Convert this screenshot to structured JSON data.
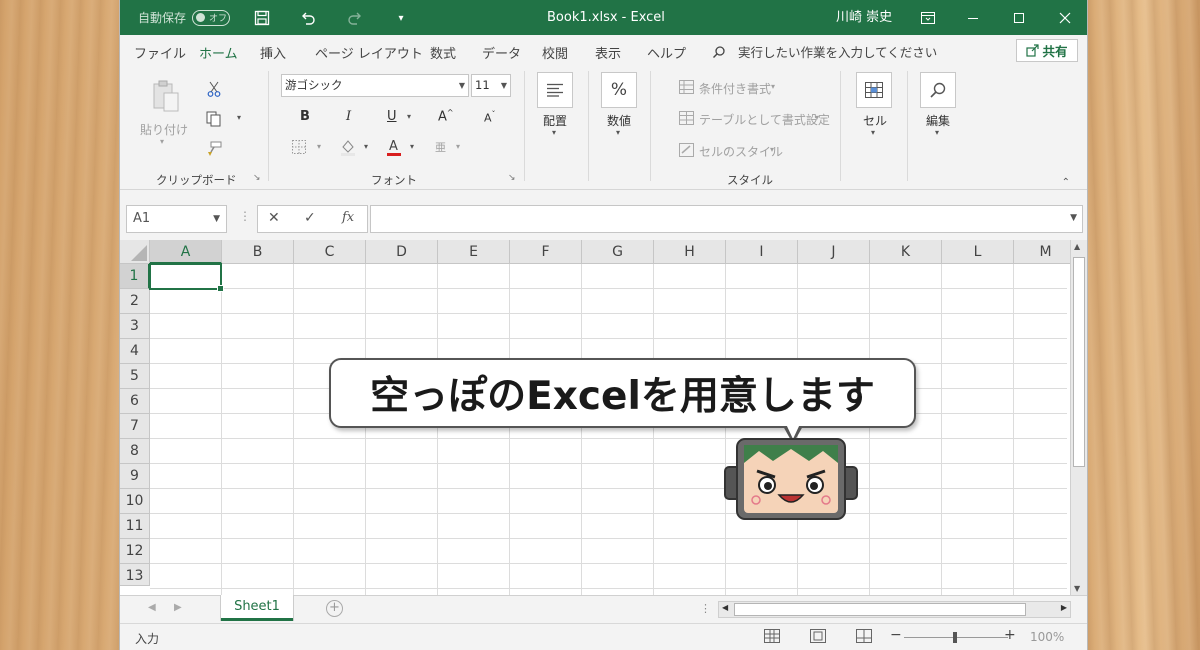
{
  "titlebar": {
    "autosave_label": "自動保存",
    "autosave_state": "オフ",
    "title": "Book1.xlsx  -  Excel",
    "user": "川崎 崇史",
    "accent": "#217346"
  },
  "tabs": [
    "ファイル",
    "ホーム",
    "挿入",
    "ページ レイアウト",
    "数式",
    "データ",
    "校閲",
    "表示",
    "ヘルプ"
  ],
  "search_hint": "実行したい作業を入力してください",
  "share_label": "共有",
  "ribbon": {
    "clipboard": {
      "paste_label": "貼り付け",
      "group_label": "クリップボード"
    },
    "font": {
      "font_name": "游ゴシック",
      "font_size": "11",
      "group_label": "フォント"
    },
    "alignment": {
      "label": "配置"
    },
    "number": {
      "label": "数値",
      "symbol": "%"
    },
    "styles": {
      "conditional": "条件付き書式",
      "table": "テーブルとして書式設定",
      "cell_styles": "セルのスタイル",
      "group_label": "スタイル"
    },
    "cells": {
      "label": "セル"
    },
    "editing": {
      "label": "編集"
    }
  },
  "formula_bar": {
    "name_box": "A1",
    "fx": "fx",
    "value": ""
  },
  "columns": [
    "A",
    "B",
    "C",
    "D",
    "E",
    "F",
    "G",
    "H",
    "I",
    "J",
    "K",
    "L",
    "M"
  ],
  "rows": [
    "1",
    "2",
    "3",
    "4",
    "5",
    "6",
    "7",
    "8",
    "9",
    "10",
    "11",
    "12",
    "13"
  ],
  "selected_cell": "A1",
  "sheets": {
    "active": "Sheet1"
  },
  "status": {
    "mode": "入力",
    "zoom": "100%"
  },
  "callout": {
    "text": "空っぽのExcelを用意します"
  }
}
